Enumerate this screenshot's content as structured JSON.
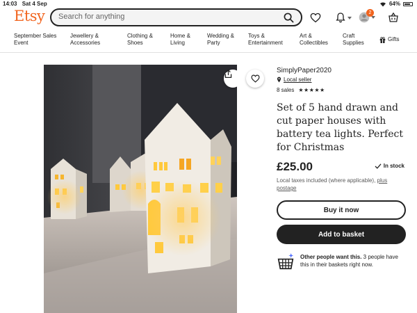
{
  "status": {
    "time": "14:03",
    "date": "Sat 4 Sep",
    "battery": "64%"
  },
  "header": {
    "logo": "Etsy",
    "search_placeholder": "Search for anything",
    "cart_badge": "2"
  },
  "nav": {
    "items": [
      {
        "line1": "September Sales",
        "line2": "Event"
      },
      {
        "line1": "Jewellery &",
        "line2": "Accessories"
      },
      {
        "line1": "Clothing &",
        "line2": "Shoes"
      },
      {
        "line1": "Home &",
        "line2": "Living"
      },
      {
        "line1": "Wedding &",
        "line2": "Party"
      },
      {
        "line1": "Toys &",
        "line2": "Entertainment"
      },
      {
        "line1": "Art &",
        "line2": "Collectibles"
      },
      {
        "line1": "Craft",
        "line2": "Supplies"
      }
    ],
    "gifts": "Gifts"
  },
  "listing": {
    "shop_name": "SimplyPaper2020",
    "local_seller": "Local seller",
    "sales": "8 sales",
    "stars": "★★★★★",
    "title": "Set of 5 hand drawn and cut paper houses with battery tea lights. Perfect for Christmas",
    "price": "£25.00",
    "stock": "In stock",
    "tax_text": "Local taxes included (where applicable), ",
    "tax_link": "plus postage",
    "buy_now": "Buy it now",
    "add_to_basket": "Add to basket",
    "demand_bold": "Other people want this.",
    "demand_text": " 3 people have this in their baskets right now."
  },
  "colors": {
    "brand": "#f1641e",
    "dark": "#222222"
  }
}
